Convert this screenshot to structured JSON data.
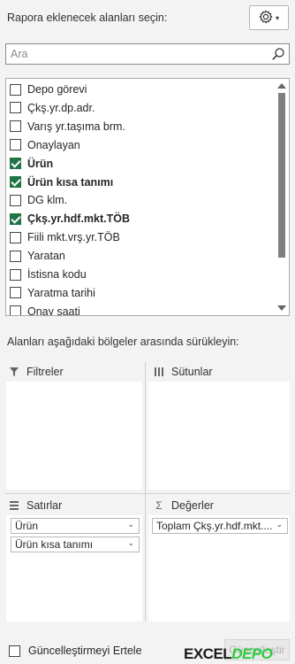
{
  "header": {
    "title": "Rapora eklenecek alanları seçin:",
    "settings_icon": "gear-icon",
    "settings_caret": "▾"
  },
  "search": {
    "placeholder": "Ara",
    "value": ""
  },
  "fields": [
    {
      "label": "Depo görevi",
      "checked": false
    },
    {
      "label": "Çkş.yr.dp.adr.",
      "checked": false
    },
    {
      "label": "Varış yr.taşıma brm.",
      "checked": false
    },
    {
      "label": "Onaylayan",
      "checked": false
    },
    {
      "label": "Ürün",
      "checked": true
    },
    {
      "label": "Ürün kısa tanımı",
      "checked": true
    },
    {
      "label": "DG klm.",
      "checked": false
    },
    {
      "label": "Çkş.yr.hdf.mkt.TÖB",
      "checked": true
    },
    {
      "label": "Fiili mkt.vrş.yr.TÖB",
      "checked": false
    },
    {
      "label": "Yaratan",
      "checked": false
    },
    {
      "label": "İstisna kodu",
      "checked": false
    },
    {
      "label": "Yaratma tarihi",
      "checked": false
    },
    {
      "label": "Onay saati",
      "checked": false
    }
  ],
  "drag_hint": "Alanları aşağıdaki bölgeler arasında sürükleyin:",
  "zones": {
    "filters": {
      "label": "Filtreler",
      "items": []
    },
    "columns": {
      "label": "Sütunlar",
      "items": []
    },
    "rows": {
      "label": "Satırlar",
      "items": [
        "Ürün",
        "Ürün kısa tanımı"
      ]
    },
    "values": {
      "label": "Değerler",
      "items": [
        "Toplam Çkş.yr.hdf.mkt...."
      ]
    }
  },
  "footer": {
    "defer_label": "Güncelleştirmeyi Ertele",
    "update_label": "Güncelleştir"
  },
  "watermark": {
    "text_dark": "EXCEL",
    "text_green": "DEPO"
  },
  "colors": {
    "check_green": "#217346",
    "panel_bg": "#f3f3f3"
  }
}
